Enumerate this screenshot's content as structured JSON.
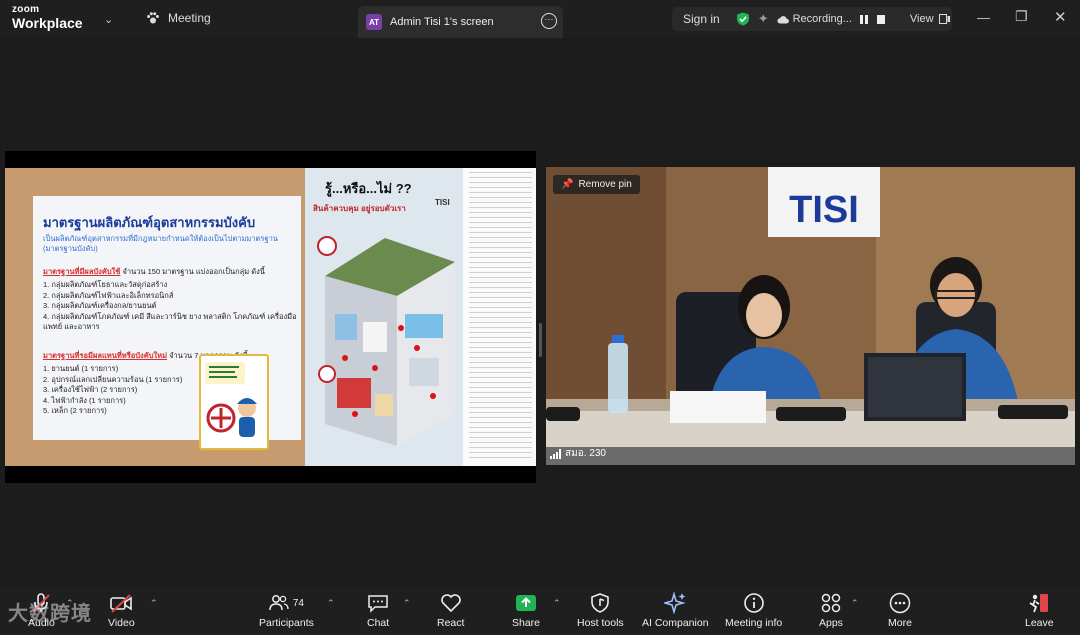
{
  "app": {
    "brand_top": "zoom",
    "brand_bottom": "Workplace"
  },
  "header": {
    "meeting_label": "Meeting",
    "screen_tab_badge": "AT",
    "screen_tab_title": "Admin Tisi 1's screen",
    "sign_in": "Sign in",
    "recording_label": "Recording...",
    "view_label": "View"
  },
  "shared_slide": {
    "title": "มาตรฐานผลิตภัณฑ์อุตสาหกรรมบังคับ",
    "subtitle": "เป็นผลิตภัณฑ์อุตสาหกรรมที่มีกฎหมายกำหนดให้ต้องเป็นไปตามมาตรฐาน (มาตรฐานบังคับ)",
    "section1_highlight": "มาตรฐานที่มีผลบังคับใช้",
    "section1_rest": " จำนวน 150 มาตรฐาน แบ่งออกเป็นกลุ่ม ดังนี้",
    "section1_items": [
      "1. กลุ่มผลิตภัณฑ์โยธาและวัสดุก่อสร้าง",
      "2. กลุ่มผลิตภัณฑ์ไฟฟ้าและอิเล็กทรอนิกส์",
      "3. กลุ่มผลิตภัณฑ์เครื่องกล/ยานยนต์",
      "4. กลุ่มผลิตภัณฑ์โภคภัณฑ์ เคมี สีและวาร์นิช ยาง พลาสติก โภคภัณฑ์ เครื่องมือแพทย์ และอาหาร"
    ],
    "section2_highlight": "มาตรฐานที่รอมีผลแทนที่หรือบังคับใหม่",
    "section2_rest": " จำนวน 7 มาตรฐาน ดังนี้",
    "section2_items": [
      "1. ยานยนต์ (1 รายการ)",
      "2. อุปกรณ์แลกเปลี่ยนความร้อน (1 รายการ)",
      "3. เครื่องใช้ไฟฟ้า (2 รายการ)",
      "4. ไฟฟ้ากำลัง (1 รายการ)",
      "5. เหล็ก (2 รายการ)"
    ],
    "poster_title": "รู้...หรือ...ไม่ ??",
    "poster_subtitle": "สินค้าควบคุม อยู่รอบตัวเรา",
    "poster_brand": "TISI"
  },
  "video": {
    "remove_pin": "Remove pin",
    "participant_name": "สมอ. 230",
    "wall_logo": "TISI"
  },
  "toolbar": {
    "audio": "Audio",
    "video": "Video",
    "participants": "Participants",
    "participants_count": "74",
    "chat": "Chat",
    "react": "React",
    "share": "Share",
    "host_tools": "Host tools",
    "ai_companion": "AI Companion",
    "meeting_info": "Meeting info",
    "apps": "Apps",
    "more": "More",
    "leave": "Leave"
  },
  "watermark": "大数跨境",
  "colors": {
    "accent_green": "#1fb455",
    "share_green": "#1fb455",
    "leave_red": "#e0454b",
    "tisi_blue": "#1b3a9a"
  }
}
